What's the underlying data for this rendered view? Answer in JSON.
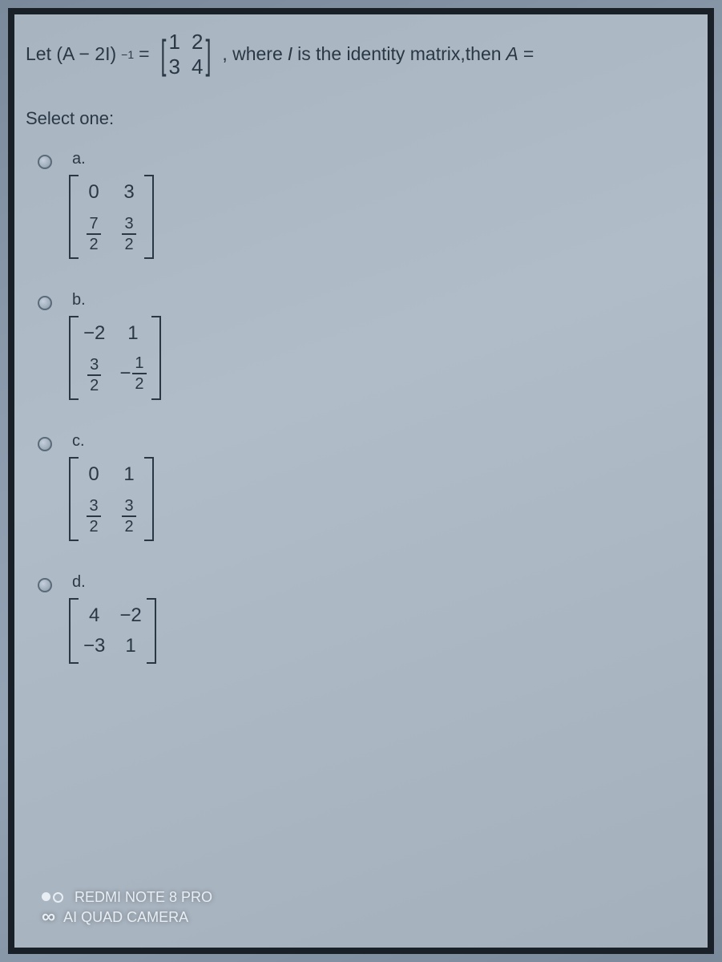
{
  "question": {
    "prefix": "Let (A − 2I)",
    "exponent": "−1",
    "equals": " = ",
    "matrix": {
      "a": "1",
      "b": "2",
      "c": "3",
      "d": "4"
    },
    "suffix": ", where ",
    "ivar": "I",
    "suffix2": " is the identity matrix,then ",
    "avar": "A",
    "suffix3": " ="
  },
  "prompt": "Select one:",
  "options": {
    "a": {
      "label": "a.",
      "cells": {
        "r1c1": "0",
        "r1c2": "3",
        "r2c1_num": "7",
        "r2c1_den": "2",
        "r2c2_num": "3",
        "r2c2_den": "2"
      }
    },
    "b": {
      "label": "b.",
      "cells": {
        "r1c1": "−2",
        "r1c2": "1",
        "r2c1_num": "3",
        "r2c1_den": "2",
        "neg": "−",
        "r2c2_num": "1",
        "r2c2_den": "2"
      }
    },
    "c": {
      "label": "c.",
      "cells": {
        "r1c1": "0",
        "r1c2": "1",
        "r2c1_num": "3",
        "r2c1_den": "2",
        "r2c2_num": "3",
        "r2c2_den": "2"
      }
    },
    "d": {
      "label": "d.",
      "cells": {
        "r1c1": "4",
        "r1c2": "−2",
        "r2c1": "−3",
        "r2c2": "1"
      }
    }
  },
  "watermark": {
    "line1": "REDMI NOTE 8 PRO",
    "line2": "AI QUAD CAMERA"
  }
}
